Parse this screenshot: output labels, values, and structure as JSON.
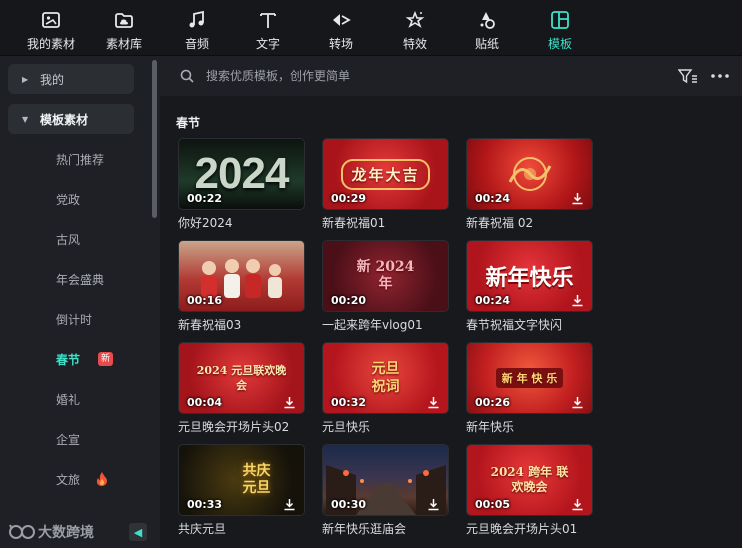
{
  "toolbar": {
    "items": [
      {
        "label": "我的素材",
        "icon": "my-media-icon"
      },
      {
        "label": "素材库",
        "icon": "library-icon"
      },
      {
        "label": "音频",
        "icon": "music-note-icon"
      },
      {
        "label": "文字",
        "icon": "text-icon"
      },
      {
        "label": "转场",
        "icon": "transition-icon"
      },
      {
        "label": "特效",
        "icon": "effects-icon"
      },
      {
        "label": "贴纸",
        "icon": "sticker-icon"
      },
      {
        "label": "模板",
        "icon": "template-icon"
      }
    ],
    "active": "模板",
    "accent": "#3fe0c8"
  },
  "sidebar": {
    "groups": [
      {
        "label": "我的",
        "expanded": false
      },
      {
        "label": "模板素材",
        "expanded": true
      }
    ],
    "items": [
      {
        "label": "热门推荐"
      },
      {
        "label": "党政"
      },
      {
        "label": "古风"
      },
      {
        "label": "年会盛典"
      },
      {
        "label": "倒计时"
      },
      {
        "label": "春节",
        "badge": "新"
      },
      {
        "label": "婚礼"
      },
      {
        "label": "企宣"
      },
      {
        "label": "文旅",
        "icon": "fire-icon"
      }
    ],
    "active": "春节",
    "brand": "大数跨境"
  },
  "search": {
    "placeholder": "搜索优质模板，创作更简单"
  },
  "section": {
    "title": "春节"
  },
  "cards": [
    {
      "name": "你好2024",
      "duration": "00:22",
      "download": false,
      "art": "2024"
    },
    {
      "name": "新春祝福01",
      "duration": "00:29",
      "download": false,
      "art": "龙年大吉"
    },
    {
      "name": "新春祝福 02",
      "duration": "00:24",
      "download": true,
      "art": ""
    },
    {
      "name": "新春祝福03",
      "duration": "00:16",
      "download": false,
      "art": ""
    },
    {
      "name": "一起来跨年vlog01",
      "duration": "00:20",
      "download": false,
      "art": "新 2024 年"
    },
    {
      "name": "春节祝福文字快闪",
      "duration": "00:24",
      "download": true,
      "art": "新年快乐"
    },
    {
      "name": "元旦晚会开场片头02",
      "duration": "00:04",
      "download": true,
      "art": "2024 元旦联欢晚会"
    },
    {
      "name": "元旦快乐",
      "duration": "00:32",
      "download": true,
      "art": "元旦 祝词"
    },
    {
      "name": "新年快乐",
      "duration": "00:26",
      "download": true,
      "art": "新 年 快 乐"
    },
    {
      "name": "共庆元旦",
      "duration": "00:33",
      "download": true,
      "art": "共庆 元旦"
    },
    {
      "name": "新年快乐逛庙会",
      "duration": "00:30",
      "download": true,
      "art": ""
    },
    {
      "name": "元旦晚会开场片头01",
      "duration": "00:05",
      "download": true,
      "art": "2024 跨年 联欢晚会"
    }
  ]
}
